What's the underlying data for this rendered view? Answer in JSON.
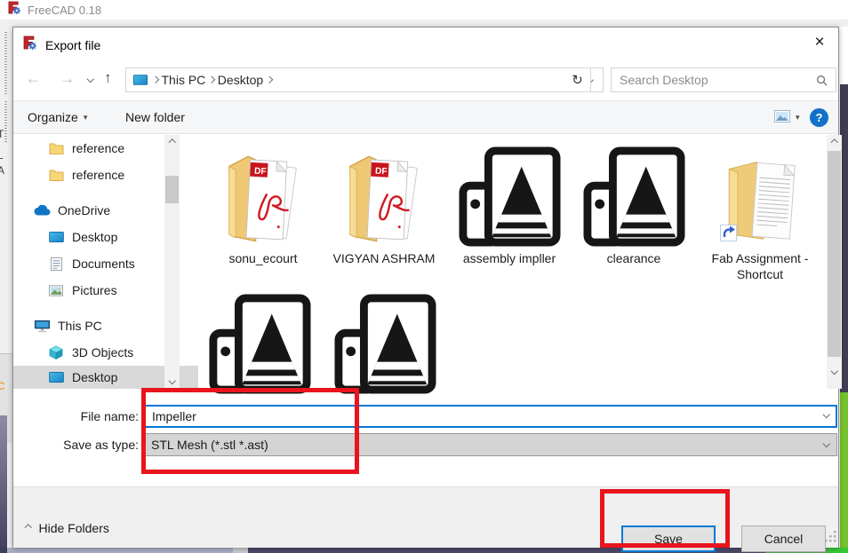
{
  "app": {
    "title": "FreeCAD 0.18"
  },
  "dialog": {
    "title": "Export file",
    "close_glyph": "×",
    "nav": {
      "back_glyph": "←",
      "forward_glyph": "→",
      "up_glyph": "↑",
      "refresh_glyph": "↻",
      "breadcrumb_items": [
        "This PC",
        "Desktop"
      ],
      "search_placeholder": "Search Desktop"
    },
    "toolbar": {
      "organize_label": "Organize",
      "new_folder_label": "New folder"
    },
    "sidebar": {
      "items": [
        {
          "label": "reference",
          "icon": "folder-icon"
        },
        {
          "label": "reference",
          "icon": "folder-icon"
        },
        {
          "label": "OneDrive",
          "icon": "onedrive-cloud-icon"
        },
        {
          "label": "Desktop",
          "icon": "desktop-monitor-icon"
        },
        {
          "label": "Documents",
          "icon": "documents-icon"
        },
        {
          "label": "Pictures",
          "icon": "pictures-icon"
        },
        {
          "label": "This PC",
          "icon": "this-pc-icon"
        },
        {
          "label": "3D Objects",
          "icon": "3d-cube-icon"
        },
        {
          "label": "Desktop",
          "icon": "desktop-monitor-icon",
          "selected": true
        }
      ]
    },
    "files": {
      "items": [
        {
          "name": "sonu_ecourt",
          "icon": "pdf-folder-icon"
        },
        {
          "name": "VIGYAN ASHRAM",
          "icon": "pdf-folder-icon"
        },
        {
          "name": "assembly impller",
          "icon": "stl-mesh-icon"
        },
        {
          "name": "clearance",
          "icon": "stl-mesh-icon"
        },
        {
          "name": "Fab Assignment - Shortcut",
          "icon": "folder-shortcut-icon"
        },
        {
          "name": "",
          "icon": "stl-mesh-icon"
        },
        {
          "name": "",
          "icon": "stl-mesh-icon"
        }
      ]
    },
    "fields": {
      "file_name_label": "File name:",
      "file_name_value": "Impeller",
      "save_type_label": "Save as type:",
      "save_type_value": "STL Mesh (*.stl *.ast)"
    },
    "footer": {
      "hide_folders_label": "Hide Folders",
      "save_label": "Save",
      "cancel_label": "Cancel"
    }
  },
  "colors": {
    "accent_blue": "#0078d7",
    "highlight_red": "#e9141d",
    "selection_gray": "#d9d9d9",
    "help_blue": "#1271c8"
  }
}
